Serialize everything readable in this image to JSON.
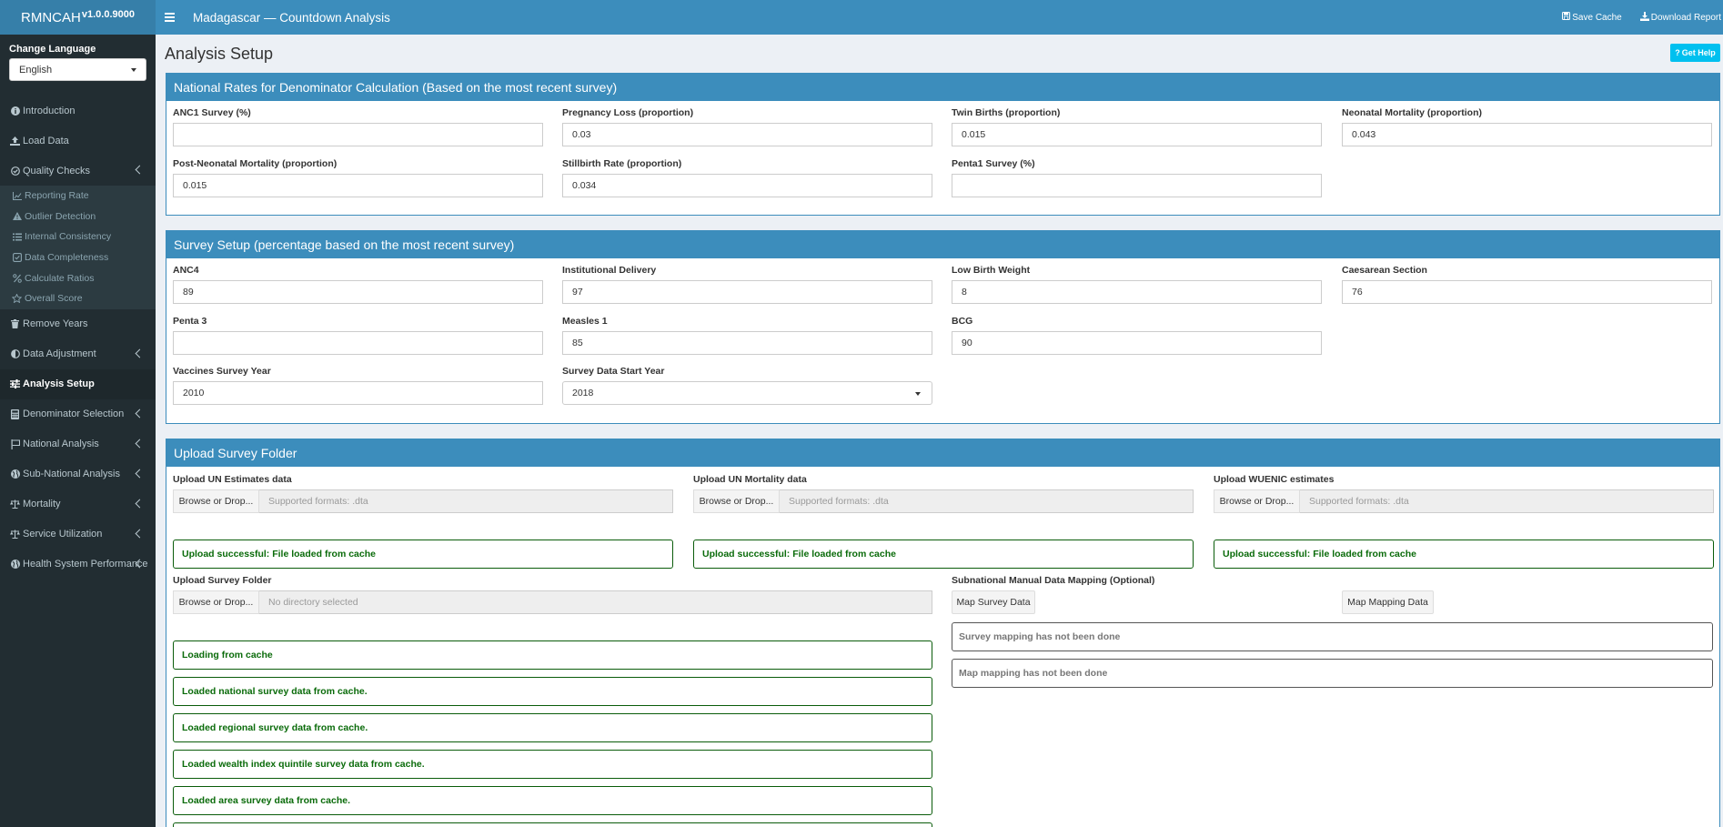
{
  "brand": {
    "name": "RMNCAH",
    "version": "v1.0.0.9000"
  },
  "header": {
    "title": "Madagascar — Countdown Analysis",
    "save_cache": "Save Cache",
    "download_report": "Download Report"
  },
  "sidebar": {
    "language_label": "Change Language",
    "language_value": "English",
    "items": [
      {
        "label": "Introduction"
      },
      {
        "label": "Load Data"
      },
      {
        "label": "Quality Checks"
      },
      {
        "label": "Remove Years"
      },
      {
        "label": "Data Adjustment"
      },
      {
        "label": "Analysis Setup"
      },
      {
        "label": "Denominator Selection"
      },
      {
        "label": "National Analysis"
      },
      {
        "label": "Sub-National Analysis"
      },
      {
        "label": "Mortality"
      },
      {
        "label": "Service Utilization"
      },
      {
        "label": "Health System Performance"
      }
    ],
    "sub_items": [
      {
        "label": "Reporting Rate"
      },
      {
        "label": "Outlier Detection"
      },
      {
        "label": "Internal Consistency"
      },
      {
        "label": "Data Completeness"
      },
      {
        "label": "Calculate Ratios"
      },
      {
        "label": "Overall Score"
      }
    ]
  },
  "page": {
    "title": "Analysis Setup",
    "help": "Get Help"
  },
  "national": {
    "title": "National Rates for Denominator Calculation (Based on the most recent survey)",
    "fields": [
      {
        "label": "ANC1 Survey (%)",
        "value": ""
      },
      {
        "label": "Pregnancy Loss (proportion)",
        "value": "0.03"
      },
      {
        "label": "Twin Births (proportion)",
        "value": "0.015"
      },
      {
        "label": "Neonatal Mortality (proportion)",
        "value": "0.043"
      },
      {
        "label": "Post-Neonatal Mortality (proportion)",
        "value": "0.015"
      },
      {
        "label": "Stillbirth Rate (proportion)",
        "value": "0.034"
      },
      {
        "label": "Penta1 Survey (%)",
        "value": ""
      }
    ]
  },
  "survey": {
    "title": "Survey Setup (percentage based on the most recent survey)",
    "fields": [
      {
        "label": "ANC4",
        "value": "89"
      },
      {
        "label": "Institutional Delivery",
        "value": "97"
      },
      {
        "label": "Low Birth Weight",
        "value": "8"
      },
      {
        "label": "Caesarean Section",
        "value": "76"
      },
      {
        "label": "Penta 3",
        "value": ""
      },
      {
        "label": "Measles 1",
        "value": "85"
      },
      {
        "label": "BCG",
        "value": "90"
      },
      {
        "label": "Vaccines Survey Year",
        "value": "2010"
      },
      {
        "label": "Survey Data Start Year",
        "value": "2018"
      }
    ]
  },
  "upload": {
    "title": "Upload Survey Folder",
    "browse": "Browse or Drop...",
    "files": [
      {
        "label": "Upload UN Estimates data",
        "placeholder": "Supported formats: .dta",
        "status": "Upload successful: File loaded from cache"
      },
      {
        "label": "Upload UN Mortality data",
        "placeholder": "Supported formats: .dta",
        "status": "Upload successful: File loaded from cache"
      },
      {
        "label": "Upload WUENIC estimates",
        "placeholder": "Supported formats: .dta",
        "status": "Upload successful: File loaded from cache"
      }
    ],
    "folder_label": "Upload Survey Folder",
    "folder_placeholder": "No directory selected",
    "mapping_label": "Subnational Manual Data Mapping (Optional)",
    "map_survey_btn": "Map Survey Data",
    "map_mapping_btn": "Map Mapping Data",
    "survey_mapping_status": "Survey mapping has not been done",
    "map_mapping_status": "Map mapping has not been done",
    "cache_messages": [
      "Loading from cache",
      "Loaded national survey data from cache.",
      "Loaded regional survey data from cache.",
      "Loaded wealth index quintile survey data from cache.",
      "Loaded area survey data from cache."
    ]
  }
}
